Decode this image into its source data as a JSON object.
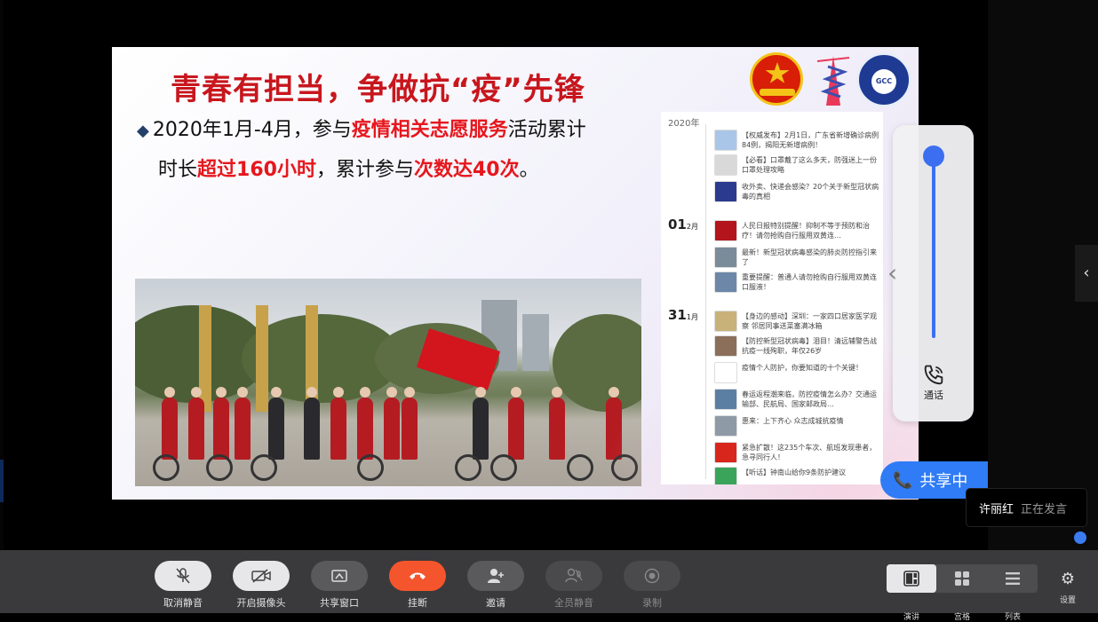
{
  "slide": {
    "title": "青春有担当，争做抗“疫”先锋",
    "line1_a": "2020年1月-4月，参与",
    "line1_hl": "疫情相关志愿服务",
    "line1_b": "活动累计",
    "line2_a": "时长",
    "line2_hl1": "超过160小时",
    "line2_b": "，累计参与",
    "line2_hl2": "次数达40次",
    "line2_c": "。"
  },
  "timeline": {
    "year": "2020年",
    "date1": "01",
    "date1_unit": "2月",
    "date2": "31",
    "date2_unit": "1月",
    "items": [
      {
        "text": "【权威发布】2月1日，广东省新增确诊病例84例，揭阳无新增病例！",
        "color": "#a9c6e8"
      },
      {
        "text": "【必看】口罩戴了这么多天，防强迷上一份口罩处理攻略",
        "color": "#d9d9d9"
      },
      {
        "text": "收外卖、快递会感染？20个关于新型冠状病毒的真相",
        "color": "#2b3a8f"
      },
      {
        "text": "人民日报特别提醒！抑制不等于预防和治疗！请勿抢购自行服用双黄连…",
        "color": "#b4141b"
      },
      {
        "text": "最新！新型冠状病毒感染的肺炎防控指引来了",
        "color": "#7a8b99"
      },
      {
        "text": "重要提醒：普通人请勿抢购自行服用双黄连口服液！",
        "color": "#6c87a8"
      },
      {
        "text": "【身边的感动】深圳：一家四口居家医学观察 邻居同事送菜塞满冰箱",
        "color": "#c9b17a"
      },
      {
        "text": "【防控新型冠状病毒】泪目！清远辅警告战抗疫一线殉职，年仅26岁",
        "color": "#8b6f5a"
      },
      {
        "text": "疫情个人防护，你要知道的十个关键！",
        "color": "#ffffff"
      },
      {
        "text": "春运返程潮来临，防控疫情怎么办？交通运输部、民航局、国家邮政局…",
        "color": "#5b7fa3"
      },
      {
        "text": "惠来：上下齐心 众志成城抗疫情",
        "color": "#8e9aa6"
      },
      {
        "text": "紧急扩散！这235个车次、航班发现患者，急寻同行人！",
        "color": "#d8261d"
      },
      {
        "text": "【听话】钟南山给你9条防护建议",
        "color": "#3aa55a"
      }
    ]
  },
  "float_panel": {
    "call_label": "通话",
    "volume_level": 1.0
  },
  "sharing": {
    "label": "共享中"
  },
  "speaker": {
    "name": "许丽红",
    "status": "正在发言"
  },
  "toolbar": {
    "buttons": [
      {
        "label": "取消静音",
        "icon": "mic-off-icon",
        "glyph": "🎙"
      },
      {
        "label": "开启摄像头",
        "icon": "camera-off-icon",
        "glyph": "📷"
      },
      {
        "label": "共享窗口",
        "icon": "share-window-icon",
        "glyph": "▣"
      },
      {
        "label": "挂断",
        "icon": "hangup-icon",
        "glyph": "☎"
      },
      {
        "label": "邀请",
        "icon": "invite-user-icon",
        "glyph": "👤"
      },
      {
        "label": "全员静音",
        "icon": "mute-all-icon",
        "glyph": "🔇"
      },
      {
        "label": "录制",
        "icon": "record-icon",
        "glyph": "◉"
      }
    ],
    "views": [
      {
        "label": "演讲",
        "icon": "speaker-view-icon",
        "glyph": "◧"
      },
      {
        "label": "宫格",
        "icon": "grid-view-icon",
        "glyph": "▦"
      },
      {
        "label": "列表",
        "icon": "list-view-icon",
        "glyph": "☰"
      }
    ],
    "settings_label": "设置",
    "settings_glyph": "⚙"
  },
  "colors": {
    "accent_red": "#c8161d",
    "highlight_red": "#e6171d",
    "share_blue": "#2f7cf6",
    "hangup": "#f5552c",
    "toolbar_bg": "#3a3a3c"
  }
}
